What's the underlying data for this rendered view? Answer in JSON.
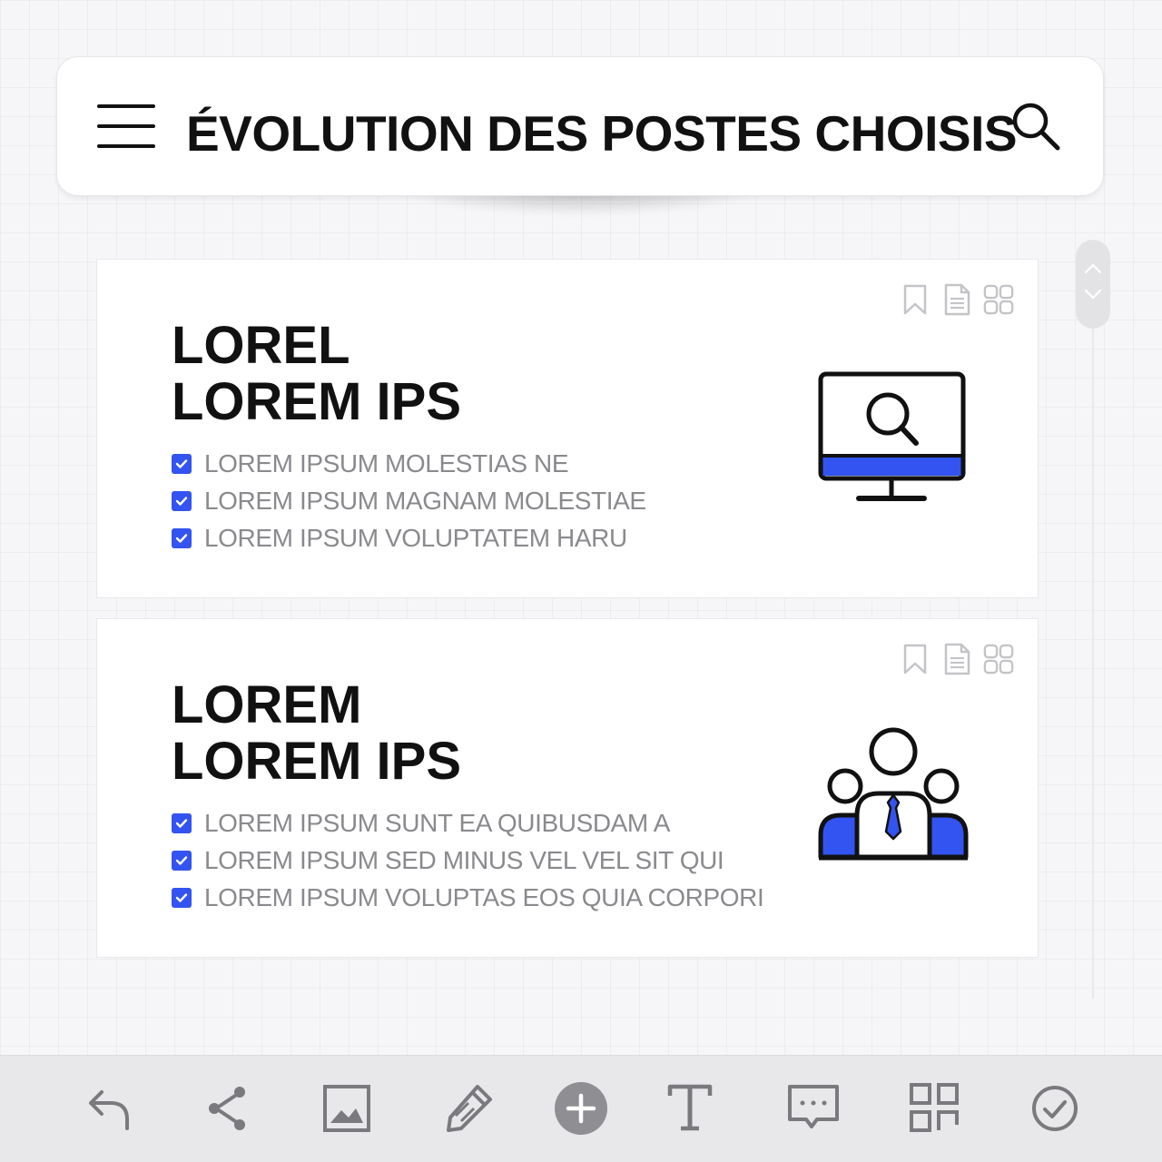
{
  "header": {
    "title": "ÉVOLUTION DES POSTES CHOISIS",
    "menu_icon": "hamburger-menu-icon",
    "search_icon": "search-icon"
  },
  "cards": [
    {
      "title_line1": "LOREL",
      "title_line2": "LOREM IPS",
      "items": [
        "LOREM IPSUM MOLESTIAS NE",
        "LOREM IPSUM MAGNAM MOLESTIAE",
        "LOREM IPSUM VOLUPTATEM HARU"
      ],
      "illustration": "monitor-search-icon",
      "tools": [
        "bookmark-icon",
        "document-icon",
        "grid-icon"
      ]
    },
    {
      "title_line1": "LOREM",
      "title_line2": "LOREM IPS",
      "items": [
        "LOREM IPSUM SUNT EA QUIBUSDAM A",
        "LOREM IPSUM SED MINUS VEL VEL SIT QUI",
        "LOREM IPSUM VOLUPTAS EOS QUIA CORPORI"
      ],
      "illustration": "team-people-icon",
      "tools": [
        "bookmark-icon",
        "document-icon",
        "grid-icon"
      ]
    }
  ],
  "toolbar": {
    "buttons": [
      "undo-icon",
      "share-icon",
      "image-icon",
      "pencil-icon",
      "add-icon",
      "text-icon",
      "comment-icon",
      "layout-icon",
      "check-icon"
    ]
  },
  "colors": {
    "accent": "#3354f0",
    "text_dark": "#111111",
    "text_muted": "#8a8a8e",
    "toolbar_bg": "#e8e8ea",
    "icon_gray": "#7a7a7e"
  }
}
